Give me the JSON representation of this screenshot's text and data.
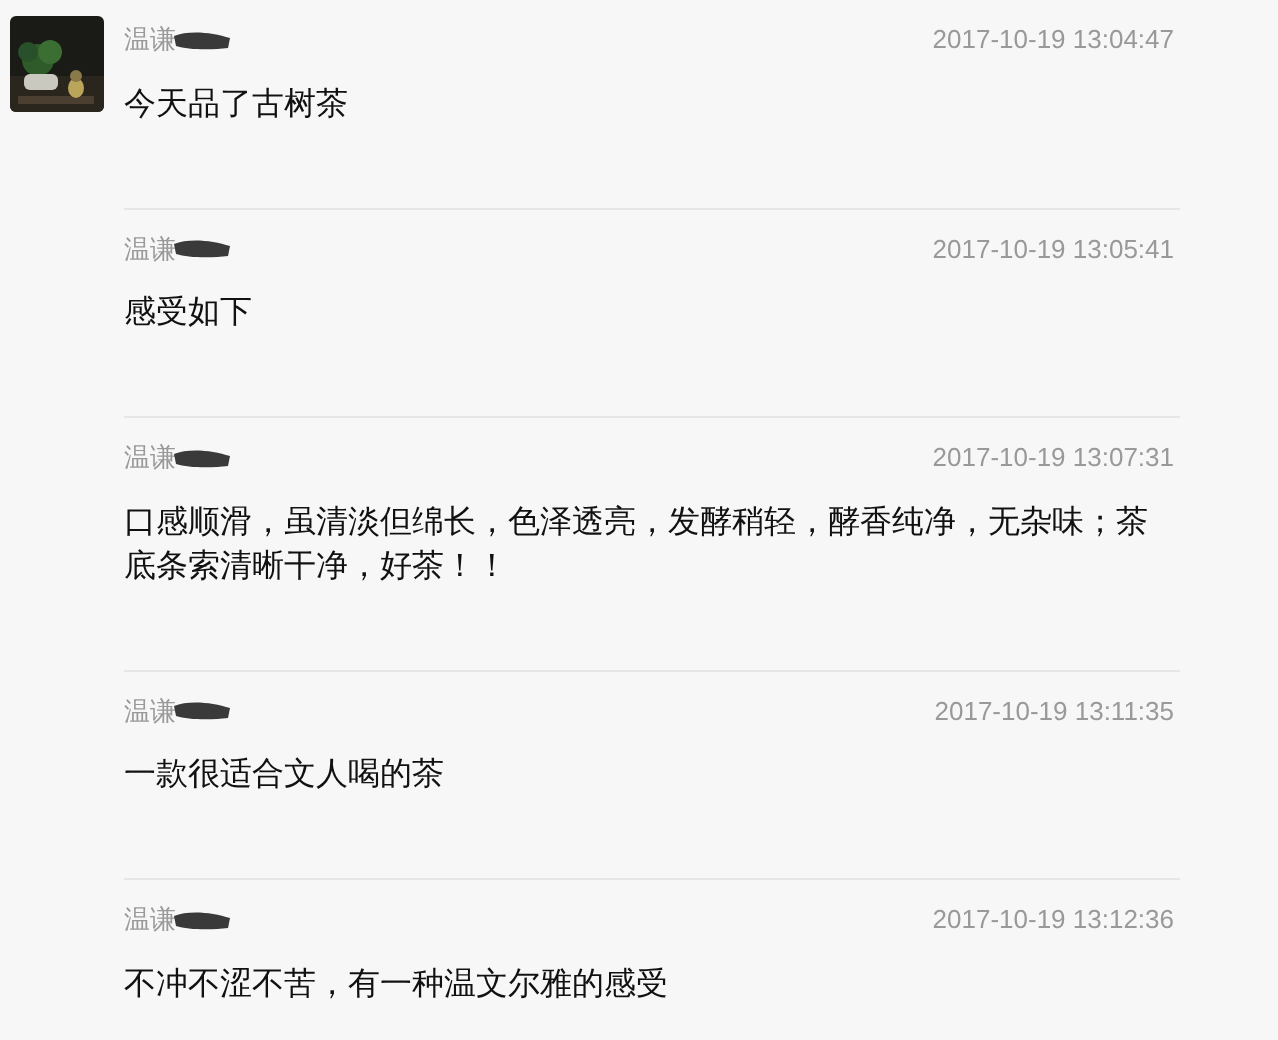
{
  "messages": [
    {
      "author": "温谦",
      "time": "2017-10-19 13:04:47",
      "text": "今天品了古树茶",
      "avatar": true
    },
    {
      "author": "温谦",
      "time": "2017-10-19 13:05:41",
      "text": "感受如下",
      "avatar": false
    },
    {
      "author": "温谦",
      "time": "2017-10-19 13:07:31",
      "text": "口感顺滑，虽清淡但绵长，色泽透亮，发酵稍轻，酵香纯净，无杂味；茶底条索清晰干净，好茶！！",
      "avatar": false
    },
    {
      "author": "温谦",
      "time": "2017-10-19 13:11:35",
      "text": "一款很适合文人喝的茶",
      "avatar": false
    },
    {
      "author": "温谦",
      "time": "2017-10-19 13:12:36",
      "text": "不冲不涩不苦，有一种温文尔雅的感受",
      "avatar": false
    }
  ]
}
